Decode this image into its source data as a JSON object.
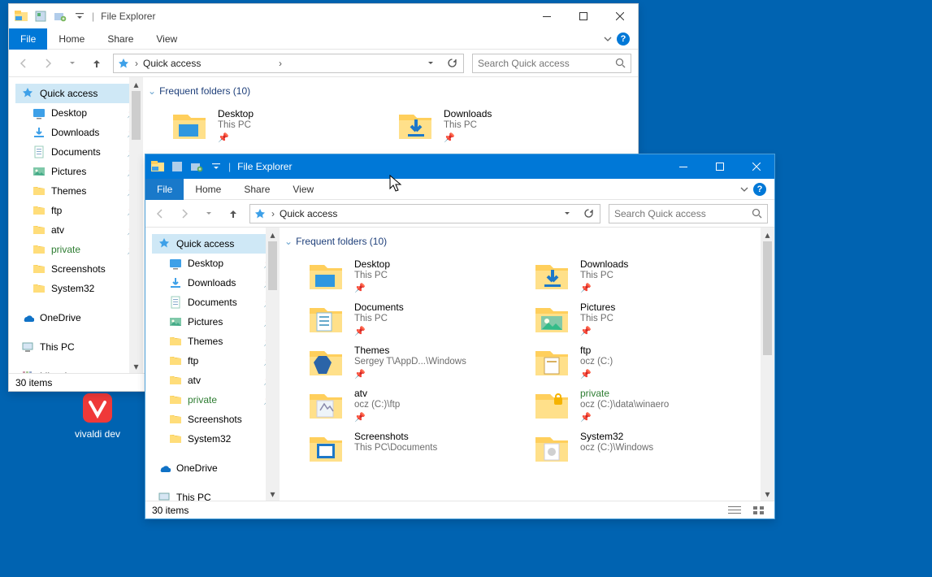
{
  "desktop": {
    "icon_label": "vivaldi dev"
  },
  "shared": {
    "title": "File Explorer",
    "ribbon": {
      "file": "File",
      "home": "Home",
      "share": "Share",
      "view": "View"
    },
    "address": {
      "label": "Quick access",
      "chevron": "›"
    },
    "search": {
      "placeholder": "Search Quick access"
    },
    "nav": {
      "root": "Quick access",
      "items": [
        {
          "label": "Desktop",
          "pinned": true,
          "kind": "desktop"
        },
        {
          "label": "Downloads",
          "pinned": true,
          "kind": "download"
        },
        {
          "label": "Documents",
          "pinned": true,
          "kind": "doc"
        },
        {
          "label": "Pictures",
          "pinned": true,
          "kind": "pic"
        },
        {
          "label": "Themes",
          "pinned": true,
          "kind": "folder"
        },
        {
          "label": "ftp",
          "pinned": true,
          "kind": "folder"
        },
        {
          "label": "atv",
          "pinned": true,
          "kind": "folder"
        },
        {
          "label": "private",
          "pinned": true,
          "kind": "folder",
          "green": true
        },
        {
          "label": "Screenshots",
          "pinned": false,
          "kind": "folder"
        },
        {
          "label": "System32",
          "pinned": false,
          "kind": "folder"
        }
      ],
      "onedrive": "OneDrive",
      "thispc": "This PC",
      "libraries": "Libraries"
    },
    "group_header": "Frequent folders (10)",
    "status": "30 items"
  },
  "win1": {
    "folders": [
      {
        "name": "Desktop",
        "loc": "This PC",
        "pinned": true,
        "kind": "desktop"
      },
      {
        "name": "Downloads",
        "loc": "This PC",
        "pinned": true,
        "kind": "download"
      }
    ]
  },
  "win2": {
    "folders": [
      {
        "name": "Desktop",
        "loc": "This PC",
        "pinned": true,
        "kind": "desktop"
      },
      {
        "name": "Downloads",
        "loc": "This PC",
        "pinned": true,
        "kind": "download"
      },
      {
        "name": "Documents",
        "loc": "This PC",
        "pinned": true,
        "kind": "doc"
      },
      {
        "name": "Pictures",
        "loc": "This PC",
        "pinned": true,
        "kind": "pic"
      },
      {
        "name": "Themes",
        "loc": "Sergey T\\AppD...\\Windows",
        "pinned": true,
        "kind": "theme"
      },
      {
        "name": "ftp",
        "loc": "ocz (C:)",
        "pinned": true,
        "kind": "ftp"
      },
      {
        "name": "atv",
        "loc": "ocz (C:)\\ftp",
        "pinned": true,
        "kind": "atv"
      },
      {
        "name": "private",
        "loc": "ocz (C:)\\data\\winaero",
        "pinned": true,
        "kind": "private",
        "green": true
      },
      {
        "name": "Screenshots",
        "loc": "This PC\\Documents",
        "pinned": false,
        "kind": "screenshots"
      },
      {
        "name": "System32",
        "loc": "ocz (C:)\\Windows",
        "pinned": false,
        "kind": "sys32"
      }
    ]
  }
}
